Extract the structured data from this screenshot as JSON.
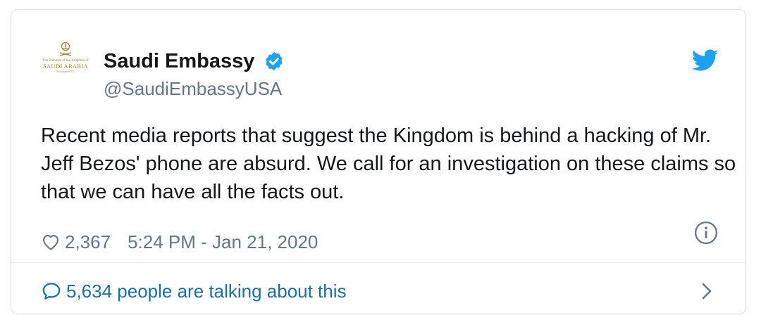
{
  "tweet": {
    "author": {
      "display_name": "Saudi Embassy",
      "handle": "@SaudiEmbassyUSA",
      "verified": true,
      "avatar": {
        "fine_print": "The Embassy of the Kingdom of",
        "name": "SAUDI ARABIA",
        "sub": "Washington, DC",
        "icon": "embassy-seal-logo"
      }
    },
    "text": "Recent media reports that suggest the Kingdom is behind a hacking of Mr. Jeff Bezos' phone are absurd. We call for an investigation on these claims so that we can have all the facts out.",
    "likes": "2,367",
    "timestamp": "5:24 PM - Jan 21, 2020",
    "talking_text": "5,634 people are talking about this"
  },
  "icons": {
    "brand": "twitter-bird-icon",
    "verified": "verified-badge-icon",
    "like": "heart-icon",
    "info": "info-icon",
    "reply": "speech-bubble-icon",
    "more": "chevron-right-icon"
  },
  "colors": {
    "twitter_blue": "#1da1f2",
    "link_blue": "#1b6fa8",
    "text_primary": "#14171a",
    "text_secondary": "#657786",
    "border": "#d9dfe4",
    "seal_gold": "#9a7b3a"
  }
}
